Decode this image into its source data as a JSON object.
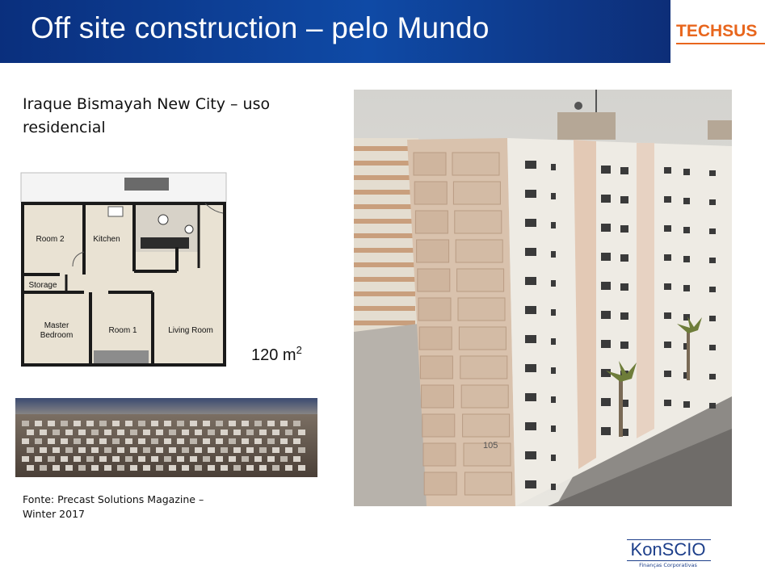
{
  "header": {
    "title": "Off site construction – pelo Mundo",
    "brand": "TECHSUS"
  },
  "content": {
    "subtitle": "Iraque  Bismayah New City – uso residencial",
    "area_value": "120 m",
    "area_unit_sup": "2",
    "source": "Fonte: Precast Solutions Magazine – Winter 2017"
  },
  "floorplan": {
    "rooms": [
      "Room 2",
      "Kitchen",
      "Storage",
      "Master",
      "Bedroom",
      "Room 1",
      "Living Room"
    ]
  },
  "building_photo": {
    "unit_number": "105"
  },
  "footer": {
    "logo_name": "KonSCIO",
    "logo_tagline": "Finanças Corporativas"
  },
  "colors": {
    "title_bar": "#0f4aa6",
    "brand": "#e8661d",
    "logo": "#1c3e8a"
  }
}
